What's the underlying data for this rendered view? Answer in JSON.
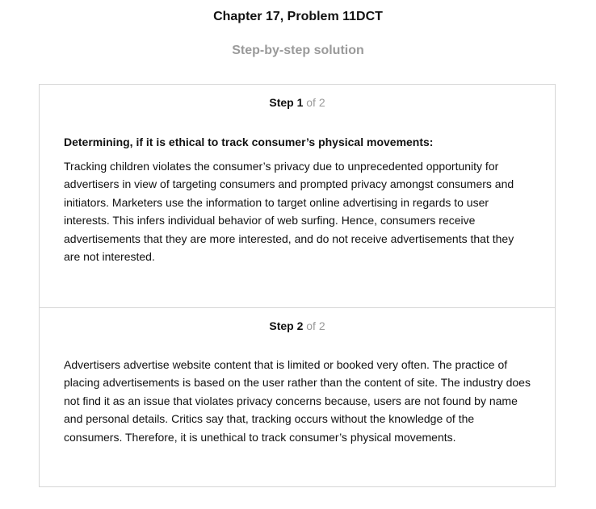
{
  "header": {
    "title": "Chapter 17, Problem 11DCT",
    "subtitle": "Step-by-step solution"
  },
  "steps": [
    {
      "label": "Step 1",
      "of_text": "of 2",
      "heading": "Determining, if it is ethical to track consumer’s physical movements:",
      "text": "Tracking children violates the consumer’s privacy due to unprecedented opportunity for advertisers in view of targeting consumers and prompted privacy amongst consumers and initiators. Marketers use the information to target online advertising in regards to user interests. This infers individual behavior of web surfing. Hence, consumers receive advertisements that they are more interested, and do not receive advertisements that they are not interested."
    },
    {
      "label": "Step 2",
      "of_text": "of 2",
      "text": "Advertisers advertise website content that is limited or booked very often. The practice of placing advertisements is based on the user rather than the content of site. The industry does not find it as an issue that violates privacy concerns because, users are not found by name and personal details. Critics say that, tracking occurs without the knowledge of the consumers. Therefore, it is unethical to track consumer’s physical movements."
    }
  ]
}
